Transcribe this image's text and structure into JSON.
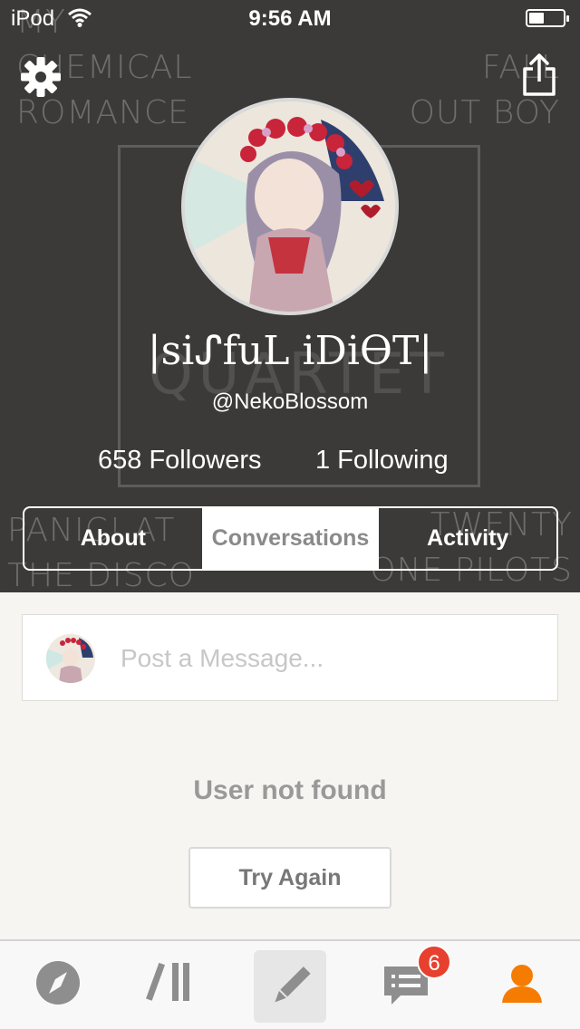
{
  "status_bar": {
    "carrier": "iPod",
    "time": "9:56 AM",
    "battery_level": 0.45
  },
  "background_art": {
    "top_left": "MY\nCHEMICAL\nROMANCE",
    "top_right": "FALL\nOUT BOY",
    "center": "QUARTET",
    "bottom_left": "PANIC! AT\nTHE DISCO",
    "bottom_right": "TWENTY\nONE PILOTS"
  },
  "header": {
    "settings_icon": "gear-icon",
    "share_icon": "share-icon",
    "display_name": "|siᔑfuL iDiƟT|",
    "handle": "@NekoBlossom",
    "followers": "658 Followers",
    "following": "1 Following"
  },
  "profile_tabs": [
    {
      "label": "About",
      "active": false
    },
    {
      "label": "Conversations",
      "active": true
    },
    {
      "label": "Activity",
      "active": false
    }
  ],
  "composer": {
    "placeholder": "Post a Message..."
  },
  "content": {
    "message": "User not found",
    "retry_label": "Try Again"
  },
  "tab_bar": {
    "items": [
      "compass-icon",
      "library-icon",
      "pencil-icon",
      "chat-icon",
      "person-icon"
    ],
    "messages_badge": "6",
    "accent_color": "#f57c00",
    "icon_color": "#8e8e8e"
  },
  "colors": {
    "header_bg": "#3b3a38",
    "content_bg": "#f6f5f1",
    "badge": "#e8402f"
  }
}
